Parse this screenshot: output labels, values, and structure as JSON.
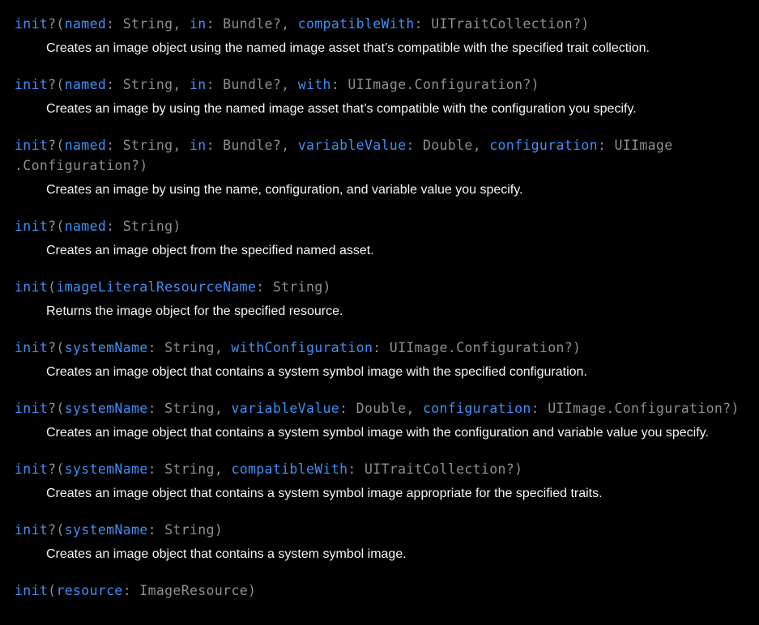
{
  "entries": [
    {
      "tokens": [
        {
          "t": "init",
          "k": "kw"
        },
        {
          "t": "?(",
          "k": "punc"
        },
        {
          "t": "named",
          "k": "lbl"
        },
        {
          "t": ": String, ",
          "k": "punc"
        },
        {
          "t": "in",
          "k": "lbl"
        },
        {
          "t": ": Bundle?, ",
          "k": "punc"
        },
        {
          "t": "compatibleWith",
          "k": "lbl"
        },
        {
          "t": ": UITraitCollection?)",
          "k": "punc"
        }
      ],
      "description": "Creates an image object using the named image asset that’s compatible with the specified trait collection."
    },
    {
      "tokens": [
        {
          "t": "init",
          "k": "kw"
        },
        {
          "t": "?(",
          "k": "punc"
        },
        {
          "t": "named",
          "k": "lbl"
        },
        {
          "t": ": String, ",
          "k": "punc"
        },
        {
          "t": "in",
          "k": "lbl"
        },
        {
          "t": ": Bundle?, ",
          "k": "punc"
        },
        {
          "t": "with",
          "k": "lbl"
        },
        {
          "t": ": UIImage.Configuration?)",
          "k": "punc"
        }
      ],
      "description": "Creates an image by using the named image asset that’s compatible with the configuration you specify."
    },
    {
      "tokens": [
        {
          "t": "init",
          "k": "kw"
        },
        {
          "t": "?(",
          "k": "punc"
        },
        {
          "t": "named",
          "k": "lbl"
        },
        {
          "t": ": String, ",
          "k": "punc"
        },
        {
          "t": "in",
          "k": "lbl"
        },
        {
          "t": ": Bundle?, ",
          "k": "punc"
        },
        {
          "t": "variableValue",
          "k": "lbl"
        },
        {
          "t": ": Double, ",
          "k": "punc"
        },
        {
          "t": "configuration",
          "k": "lbl"
        },
        {
          "t": ": UIImage\n.Configuration?)",
          "k": "punc"
        }
      ],
      "description": "Creates an image by using the name, configuration, and variable value you specify."
    },
    {
      "tokens": [
        {
          "t": "init",
          "k": "kw"
        },
        {
          "t": "?(",
          "k": "punc"
        },
        {
          "t": "named",
          "k": "lbl"
        },
        {
          "t": ": String)",
          "k": "punc"
        }
      ],
      "description": "Creates an image object from the specified named asset."
    },
    {
      "tokens": [
        {
          "t": "init",
          "k": "kw"
        },
        {
          "t": "(",
          "k": "punc"
        },
        {
          "t": "imageLiteralResourceName",
          "k": "lbl"
        },
        {
          "t": ": String)",
          "k": "punc"
        }
      ],
      "description": "Returns the image object for the specified resource."
    },
    {
      "tokens": [
        {
          "t": "init",
          "k": "kw"
        },
        {
          "t": "?(",
          "k": "punc"
        },
        {
          "t": "systemName",
          "k": "lbl"
        },
        {
          "t": ": String, ",
          "k": "punc"
        },
        {
          "t": "withConfiguration",
          "k": "lbl"
        },
        {
          "t": ": UIImage.Configuration?)",
          "k": "punc"
        }
      ],
      "description": "Creates an image object that contains a system symbol image with the specified configuration."
    },
    {
      "tokens": [
        {
          "t": "init",
          "k": "kw"
        },
        {
          "t": "?(",
          "k": "punc"
        },
        {
          "t": "systemName",
          "k": "lbl"
        },
        {
          "t": ": String, ",
          "k": "punc"
        },
        {
          "t": "variableValue",
          "k": "lbl"
        },
        {
          "t": ": Double, ",
          "k": "punc"
        },
        {
          "t": "configuration",
          "k": "lbl"
        },
        {
          "t": ": UIImage.Configuration?)",
          "k": "punc"
        }
      ],
      "description": "Creates an image object that contains a system symbol image with the configuration and variable value you specify."
    },
    {
      "tokens": [
        {
          "t": "init",
          "k": "kw"
        },
        {
          "t": "?(",
          "k": "punc"
        },
        {
          "t": "systemName",
          "k": "lbl"
        },
        {
          "t": ": String, ",
          "k": "punc"
        },
        {
          "t": "compatibleWith",
          "k": "lbl"
        },
        {
          "t": ": UITraitCollection?)",
          "k": "punc"
        }
      ],
      "description": "Creates an image object that contains a system symbol image appropriate for the specified traits."
    },
    {
      "tokens": [
        {
          "t": "init",
          "k": "kw"
        },
        {
          "t": "?(",
          "k": "punc"
        },
        {
          "t": "systemName",
          "k": "lbl"
        },
        {
          "t": ": String)",
          "k": "punc"
        }
      ],
      "description": "Creates an image object that contains a system symbol image."
    },
    {
      "tokens": [
        {
          "t": "init",
          "k": "kw"
        },
        {
          "t": "(",
          "k": "punc"
        },
        {
          "t": "resource",
          "k": "lbl"
        },
        {
          "t": ": ImageResource)",
          "k": "punc"
        }
      ],
      "description": ""
    }
  ]
}
